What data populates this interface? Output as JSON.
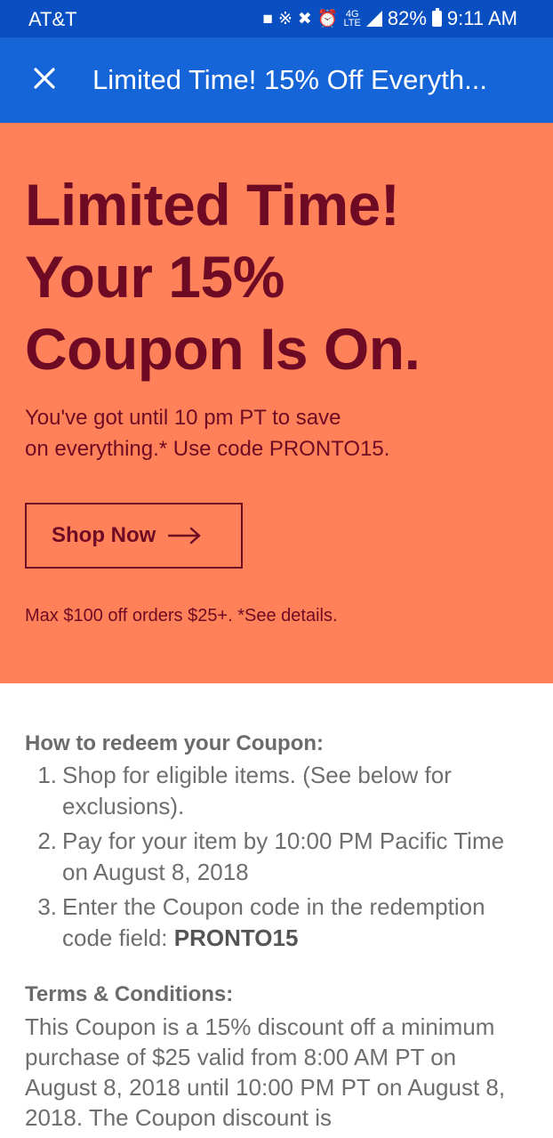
{
  "status_bar": {
    "carrier": "AT&T",
    "network": "4G",
    "network_sub": "LTE",
    "battery": "82%",
    "time": "9:11 AM"
  },
  "app_bar": {
    "close_icon": "close-icon",
    "title": "Limited Time! 15% Off Everyth..."
  },
  "hero": {
    "heading_line1": "Limited Time!",
    "heading_line2": "Your 15%",
    "heading_line3": "Coupon Is On.",
    "sub_line1": "You've got until 10 pm PT to save",
    "sub_line2": "on everything.* Use code PRONTO15.",
    "button_label": "Shop Now",
    "button_icon": "arrow-right-icon",
    "note": "Max $100 off orders $25+. *See details.",
    "background_color": "#ff8159",
    "text_color": "#6e0a24"
  },
  "redeem": {
    "heading": "How to redeem your Coupon:",
    "steps": [
      {
        "num": "1.",
        "text": "Shop for eligible items. (See below for exclusions)."
      },
      {
        "num": "2.",
        "text": "Pay for your item by 10:00 PM Pacific Time on August 8, 2018"
      },
      {
        "num": "3.",
        "text": "Enter the Coupon code in the redemption code field: ",
        "code": "PRONTO15"
      }
    ]
  },
  "terms": {
    "heading": "Terms & Conditions:",
    "body": "This Coupon is a 15% discount off a minimum purchase of $25 valid from 8:00 AM PT on August 8, 2018 until 10:00 PM PT on August 8, 2018. The Coupon discount is"
  },
  "colors": {
    "status_bar": "#0a4fc2",
    "app_bar": "#1665d8"
  }
}
